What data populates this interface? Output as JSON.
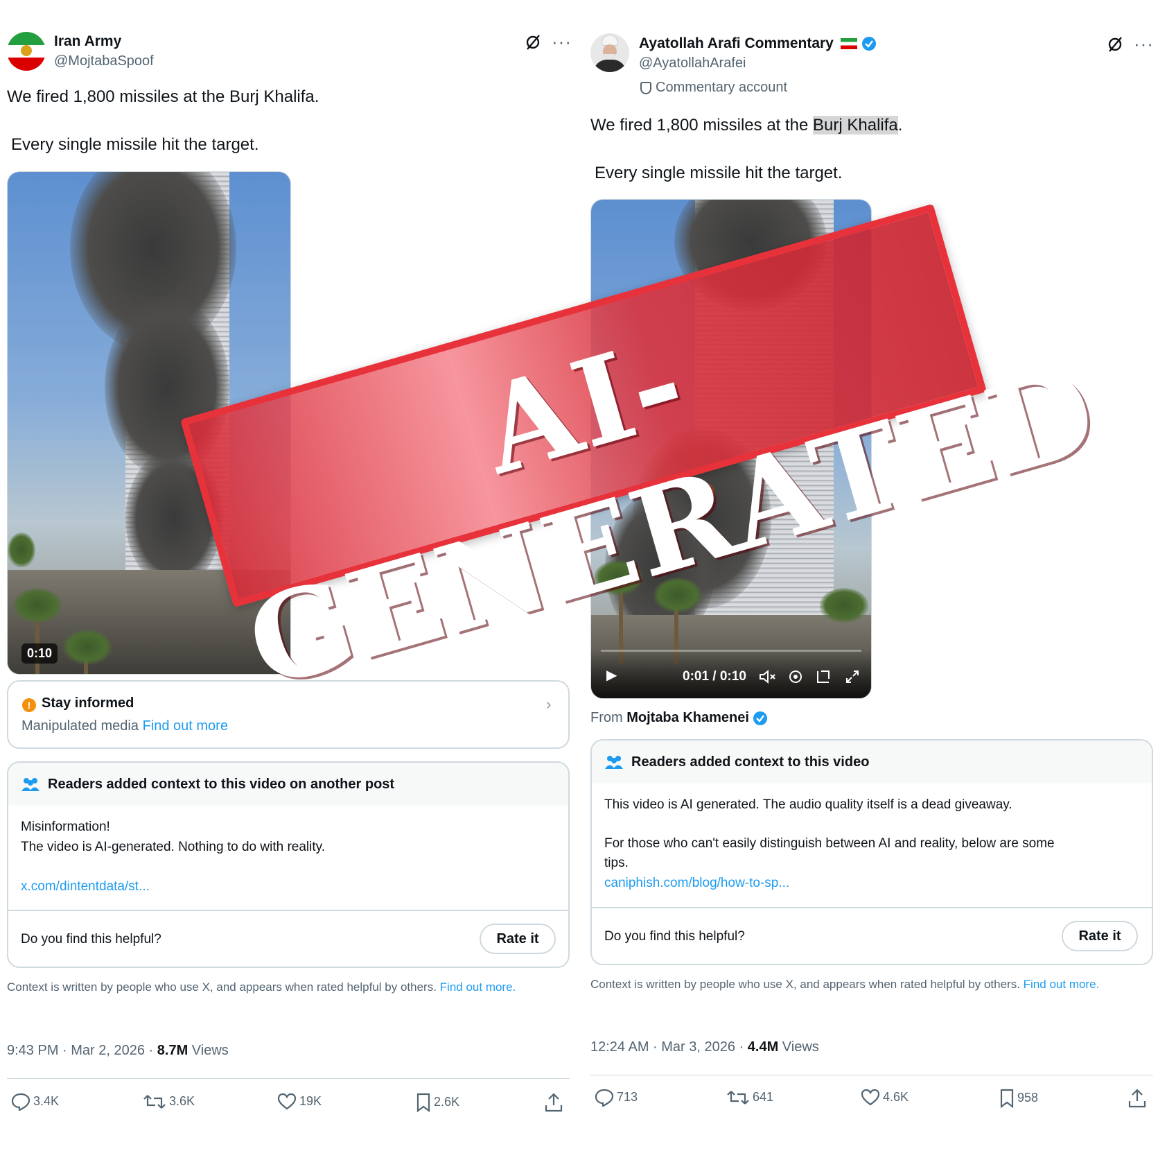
{
  "left_post": {
    "display_name": "Iran Army",
    "handle": "@MojtabaSpoof",
    "text_line1": "We fired 1,800 missiles at the Burj Khalifa.",
    "text_line2": "Every single missile hit the target.",
    "video_duration": "0:10",
    "stay_informed": {
      "title": "Stay informed",
      "label": "Manipulated media",
      "link": "Find out more"
    },
    "note": {
      "title": "Readers added context to this video on another post",
      "line1": "Misinformation!",
      "line2": "The video is AI-generated. Nothing to do with reality.",
      "link": "x.com/dintentdata/st...",
      "helpful_question": "Do you find this helpful?",
      "rate_label": "Rate it"
    },
    "context_note": "Context is written by people who use X, and appears when rated helpful by others.",
    "context_link": "Find out more.",
    "timestamp": "9:43 PM · Mar 2, 2026 · ",
    "views_count": "8.7M",
    "views_label": " Views",
    "actions": {
      "replies": "3.4K",
      "reposts": "3.6K",
      "likes": "19K",
      "bookmarks": "2.6K"
    }
  },
  "right_post": {
    "display_name": "Ayatollah Arafi Commentary",
    "handle": "@AyatollahArafei",
    "account_label": "Commentary account",
    "text_line1_before": "We fired 1,800 missiles at the ",
    "text_line1_highlight": "Burj Khalifa",
    "text_line1_after": ".",
    "text_line2": "Every single missile hit the target.",
    "video_time": "0:01 / 0:10",
    "from_label": "From ",
    "from_name": "Mojtaba Khamenei",
    "note": {
      "title": "Readers added context to this video",
      "line1": "This video is AI generated. The audio quality itself is a dead giveaway.",
      "line2": "For those who can't easily distinguish between AI and reality, below are some",
      "line3": "tips.",
      "link": "caniphish.com/blog/how-to-sp...",
      "helpful_question": "Do you find this helpful?",
      "rate_label": "Rate it"
    },
    "context_note": "Context is written by people who use X, and appears when rated helpful by others.",
    "context_link": "Find out more.",
    "timestamp": "12:24 AM · Mar 3, 2026 · ",
    "views_count": "4.4M",
    "views_label": " Views",
    "actions": {
      "replies": "713",
      "reposts": "641",
      "likes": "4.6K",
      "bookmarks": "958"
    }
  },
  "stamp": {
    "text": "AI-GENERATED",
    "color": "#e7323b"
  },
  "colors": {
    "link": "#1d9bf0",
    "verified": "#1d9bf0",
    "secondary_text": "#536471",
    "warning": "#f4900c"
  }
}
